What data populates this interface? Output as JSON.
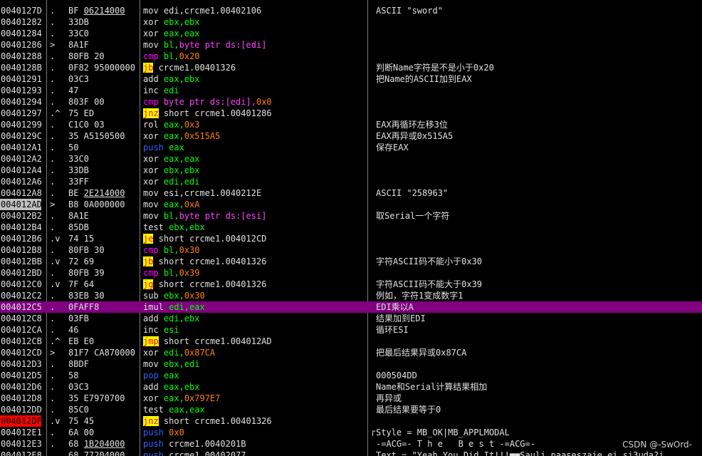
{
  "rows": [
    {
      "addr": "0040127D",
      "mark": ".",
      "hex": "BF ",
      "hexu": "06214000",
      "tokens": [
        [
          "mov",
          "mn"
        ],
        [
          " edi,crcme1.00402106",
          "op"
        ]
      ],
      "comment": "ASCII \"sword\""
    },
    {
      "addr": "00401282",
      "mark": ".",
      "hex": "33DB",
      "tokens": [
        [
          "xor",
          "mn"
        ],
        [
          " ebx,ebx",
          "reg"
        ]
      ],
      "comment": ""
    },
    {
      "addr": "00401284",
      "mark": ".",
      "hex": "33C0",
      "tokens": [
        [
          "xor",
          "mn"
        ],
        [
          " eax,eax",
          "reg"
        ]
      ],
      "comment": ""
    },
    {
      "addr": "00401286",
      "mark": ">",
      "hex": "8A1F",
      "tokens": [
        [
          "mov",
          "mn"
        ],
        [
          " bl,",
          "reg"
        ],
        [
          "byte ptr ds:[edi]",
          "mem"
        ]
      ],
      "comment": ""
    },
    {
      "addr": "00401288",
      "mark": ".",
      "hex": "80FB 20",
      "tokens": [
        [
          "cmp",
          "cmp"
        ],
        [
          " bl,",
          "reg"
        ],
        [
          "0x20",
          "num"
        ]
      ],
      "comment": ""
    },
    {
      "addr": "0040128B",
      "mark": ".",
      "hex": "0F82 95000000",
      "tokens": [
        [
          "jb",
          "jcc"
        ],
        [
          " crcme1.00401326",
          "op"
        ]
      ],
      "comment": "判断Name字符是不是小于0x20"
    },
    {
      "addr": "00401291",
      "mark": ".",
      "hex": "03C3",
      "tokens": [
        [
          "add",
          "mn"
        ],
        [
          " eax,ebx",
          "reg"
        ]
      ],
      "comment": "把Name的ASCII加到EAX"
    },
    {
      "addr": "00401293",
      "mark": ".",
      "hex": "47",
      "tokens": [
        [
          "inc",
          "mn"
        ],
        [
          " edi",
          "reg"
        ]
      ],
      "comment": ""
    },
    {
      "addr": "00401294",
      "mark": ".",
      "hex": "803F 00",
      "tokens": [
        [
          "cmp",
          "cmp"
        ],
        [
          " byte ptr ds:[edi],",
          "mem"
        ],
        [
          "0x0",
          "num"
        ]
      ],
      "comment": ""
    },
    {
      "addr": "00401297",
      "mark": ".^",
      "hex": "75 ED",
      "tokens": [
        [
          "jnz",
          "jcc"
        ],
        [
          " short crcme1.00401286",
          "op"
        ]
      ],
      "comment": ""
    },
    {
      "addr": "00401299",
      "mark": ".",
      "hex": "C1C0 03",
      "tokens": [
        [
          "rol",
          "mn"
        ],
        [
          " eax,",
          "reg"
        ],
        [
          "0x3",
          "num"
        ]
      ],
      "comment": "EAX再循环左移3位"
    },
    {
      "addr": "0040129C",
      "mark": ".",
      "hex": "35 A5150500",
      "tokens": [
        [
          "xor",
          "mn"
        ],
        [
          " eax,",
          "reg"
        ],
        [
          "0x515A5",
          "num"
        ]
      ],
      "comment": "EAX再异或0x515A5"
    },
    {
      "addr": "004012A1",
      "mark": ".",
      "hex": "50",
      "tokens": [
        [
          "push",
          "push"
        ],
        [
          " eax",
          "reg"
        ]
      ],
      "comment": "保存EAX"
    },
    {
      "addr": "004012A2",
      "mark": ".",
      "hex": "33C0",
      "tokens": [
        [
          "xor",
          "mn"
        ],
        [
          " eax,eax",
          "reg"
        ]
      ],
      "comment": ""
    },
    {
      "addr": "004012A4",
      "mark": ".",
      "hex": "33DB",
      "tokens": [
        [
          "xor",
          "mn"
        ],
        [
          " ebx,ebx",
          "reg"
        ]
      ],
      "comment": ""
    },
    {
      "addr": "004012A6",
      "mark": ".",
      "hex": "33FF",
      "tokens": [
        [
          "xor",
          "mn"
        ],
        [
          " edi,edi",
          "reg"
        ]
      ],
      "comment": ""
    },
    {
      "addr": "004012A8",
      "mark": ".",
      "hex": "BE ",
      "hexu": "2E214000",
      "tokens": [
        [
          "mov",
          "mn"
        ],
        [
          " esi,crcme1.0040212E",
          "op"
        ]
      ],
      "comment": "ASCII \"258963\""
    },
    {
      "addr": "004012AD",
      "mark": ">",
      "hex": "B8 0A000000",
      "tokens": [
        [
          "mov",
          "mn"
        ],
        [
          " eax,",
          "reg"
        ],
        [
          "0xA",
          "num"
        ]
      ],
      "comment": "",
      "addrStyle": "sel"
    },
    {
      "addr": "004012B2",
      "mark": ".",
      "hex": "8A1E",
      "tokens": [
        [
          "mov",
          "mn"
        ],
        [
          " bl,",
          "reg"
        ],
        [
          "byte ptr ds:[esi]",
          "mem"
        ]
      ],
      "comment": "取Serial一个字符"
    },
    {
      "addr": "004012B4",
      "mark": ".",
      "hex": "85DB",
      "tokens": [
        [
          "test",
          "mn"
        ],
        [
          " ebx,ebx",
          "reg"
        ]
      ],
      "comment": ""
    },
    {
      "addr": "004012B6",
      "mark": ".v",
      "hex": "74 15",
      "tokens": [
        [
          "je",
          "jcc"
        ],
        [
          " short crcme1.004012CD",
          "op"
        ]
      ],
      "comment": ""
    },
    {
      "addr": "004012B8",
      "mark": ".",
      "hex": "80FB 30",
      "tokens": [
        [
          "cmp",
          "cmp"
        ],
        [
          " bl,",
          "reg"
        ],
        [
          "0x30",
          "num"
        ]
      ],
      "comment": ""
    },
    {
      "addr": "004012BB",
      "mark": ".v",
      "hex": "72 69",
      "tokens": [
        [
          "jb",
          "jcc"
        ],
        [
          " short crcme1.00401326",
          "op"
        ]
      ],
      "comment": "字符ASCII码不能小于0x30"
    },
    {
      "addr": "004012BD",
      "mark": ".",
      "hex": "80FB 39",
      "tokens": [
        [
          "cmp",
          "cmp"
        ],
        [
          " bl,",
          "reg"
        ],
        [
          "0x39",
          "num"
        ]
      ],
      "comment": ""
    },
    {
      "addr": "004012C0",
      "mark": ".v",
      "hex": "7F 64",
      "tokens": [
        [
          "jg",
          "jcc"
        ],
        [
          " short crcme1.00401326",
          "op"
        ]
      ],
      "comment": "字符ASCII码不能大于0x39"
    },
    {
      "addr": "004012C2",
      "mark": ".",
      "hex": "83EB 30",
      "tokens": [
        [
          "sub",
          "mn"
        ],
        [
          " ebx,",
          "reg"
        ],
        [
          "0x30",
          "num"
        ]
      ],
      "comment": "例如，字符1变成数字1"
    },
    {
      "addr": "004012C5",
      "mark": ".",
      "hex": "0FAFF8",
      "tokens": [
        [
          "imul",
          "mn"
        ],
        [
          " edi,eax",
          "reg"
        ]
      ],
      "comment": "EDI乘以A",
      "hl": true
    },
    {
      "addr": "004012C8",
      "mark": ".",
      "hex": "03FB",
      "tokens": [
        [
          "add",
          "mn"
        ],
        [
          " edi,ebx",
          "reg"
        ]
      ],
      "comment": "结果加到EDI"
    },
    {
      "addr": "004012CA",
      "mark": ".",
      "hex": "46",
      "tokens": [
        [
          "inc",
          "mn"
        ],
        [
          " esi",
          "reg"
        ]
      ],
      "comment": "循环ESI"
    },
    {
      "addr": "004012CB",
      "mark": ".^",
      "hex": "EB E0",
      "tokens": [
        [
          "jmp",
          "jcc"
        ],
        [
          " short crcme1.004012AD",
          "op"
        ]
      ],
      "comment": ""
    },
    {
      "addr": "004012CD",
      "mark": ">",
      "hex": "81F7 CA870000",
      "tokens": [
        [
          "xor",
          "mn"
        ],
        [
          " edi,",
          "reg"
        ],
        [
          "0x87CA",
          "num"
        ]
      ],
      "comment": "把最后结果异或0x87CA"
    },
    {
      "addr": "004012D3",
      "mark": ".",
      "hex": "8BDF",
      "tokens": [
        [
          "mov",
          "mn"
        ],
        [
          " ebx,edi",
          "reg"
        ]
      ],
      "comment": ""
    },
    {
      "addr": "004012D5",
      "mark": ".",
      "hex": "58",
      "tokens": [
        [
          "pop",
          "push"
        ],
        [
          " eax",
          "reg"
        ]
      ],
      "comment": "000504DD"
    },
    {
      "addr": "004012D6",
      "mark": ".",
      "hex": "03C3",
      "tokens": [
        [
          "add",
          "mn"
        ],
        [
          " eax,ebx",
          "reg"
        ]
      ],
      "comment": "Name和Serial计算结果相加"
    },
    {
      "addr": "004012D8",
      "mark": ".",
      "hex": "35 E7970700",
      "tokens": [
        [
          "xor",
          "mn"
        ],
        [
          " eax,",
          "reg"
        ],
        [
          "0x797E7",
          "num"
        ]
      ],
      "comment": "再异或"
    },
    {
      "addr": "004012DD",
      "mark": ".",
      "hex": "85C0",
      "tokens": [
        [
          "test",
          "mn"
        ],
        [
          " eax,eax",
          "reg"
        ]
      ],
      "comment": "最后结果要等于0"
    },
    {
      "addr": "004012DF",
      "mark": ".v",
      "hex": "75 45",
      "tokens": [
        [
          "jnz",
          "jcc"
        ],
        [
          " short crcme1.00401326",
          "op"
        ]
      ],
      "comment": "",
      "addrStyle": "bp"
    },
    {
      "addr": "004012E1",
      "mark": ".",
      "hex": "6A 00",
      "tokens": [
        [
          "push",
          "push"
        ],
        [
          " ",
          "op"
        ],
        [
          "0x0",
          "num"
        ]
      ],
      "comment": "Style = MB_OK|MB_APPLMODAL"
    },
    {
      "addr": "004012E3",
      "mark": ".",
      "hex": "68 ",
      "hexu": "1B204000",
      "tokens": [
        [
          "push",
          "push"
        ],
        [
          " crcme1.0040201B",
          "op"
        ]
      ],
      "comment": "-=ACG=- T h e   B e s t -=ACG=-"
    },
    {
      "addr": "004012E8",
      "mark": ".",
      "hex": "68 ",
      "hexu": "77204000",
      "tokens": [
        [
          "push",
          "push"
        ],
        [
          " crcme1.00402077",
          "op"
        ]
      ],
      "comment": "Text = \"Yeah You Did It!!!■■Sauli paaseszaje ei si3uda?i…"
    }
  ],
  "watermark": "CSDN @-SwOrd-"
}
